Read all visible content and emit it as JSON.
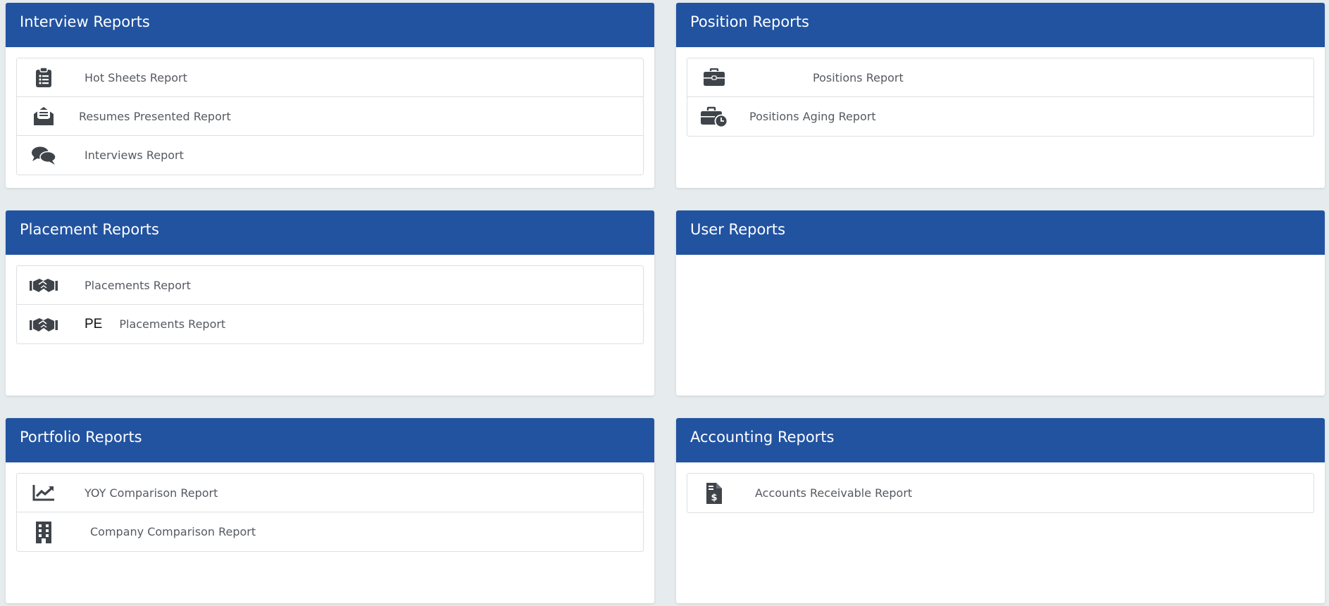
{
  "colors": {
    "header": "#2253a0",
    "icon": "#3f444a",
    "text": "#555a60"
  },
  "interview": {
    "title": "Interview Reports",
    "items": [
      {
        "label": "Hot Sheets Report",
        "icon": "clipboard-list-icon"
      },
      {
        "label": "Resumes Presented Report",
        "icon": "envelope-open-text-icon"
      },
      {
        "label": "Interviews Report",
        "icon": "comments-icon"
      }
    ]
  },
  "position": {
    "title": "Position Reports",
    "items": [
      {
        "label": "Positions Report",
        "icon": "briefcase-icon"
      },
      {
        "label": "Positions Aging Report",
        "icon": "business-time-icon"
      }
    ]
  },
  "placement": {
    "title": "Placement Reports",
    "items": [
      {
        "label": "Placements Report",
        "icon": "handshake-icon"
      },
      {
        "prefix": "PE",
        "label": "Placements Report",
        "icon": "handshake-icon"
      }
    ]
  },
  "user": {
    "title": "User Reports"
  },
  "portfolio": {
    "title": "Portfolio Reports",
    "items": [
      {
        "label": "YOY Comparison Report",
        "icon": "chart-line-icon"
      },
      {
        "label": "Company Comparison Report",
        "icon": "building-icon"
      }
    ]
  },
  "accounting": {
    "title": "Accounting Reports",
    "items": [
      {
        "label": "Accounts Receivable Report",
        "icon": "file-invoice-dollar-icon"
      }
    ]
  }
}
